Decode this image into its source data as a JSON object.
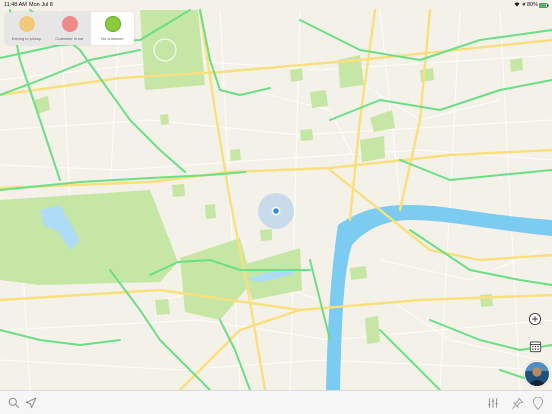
{
  "status_bar": {
    "time": "11:48 AM",
    "date": "Mon Jul 8",
    "battery": "80%"
  },
  "status_segment": {
    "options": [
      {
        "label": "Driving to pickup",
        "color": "#f2c879",
        "active": false
      },
      {
        "label": "Customer in car",
        "color": "#ee8a8a",
        "active": false
      },
      {
        "label": "No customer",
        "color": "#8acc3a",
        "active": true
      }
    ]
  },
  "map": {
    "colors": {
      "land": "#f4f1e8",
      "park": "#c6e6a6",
      "river": "#7ccbf0",
      "major_road": "#f9e07c",
      "road": "#ffffff",
      "cycle": "#6adf86",
      "location": "#2f8cf0"
    }
  },
  "controls": {
    "zoom_in_icon": "plus-circle-icon",
    "calendar_icon": "calendar-icon"
  },
  "bottom_bar": {
    "icons": [
      "search-icon",
      "navigate-arrow-icon",
      "filters-icon",
      "pin-icon",
      "map-pin-icon"
    ]
  }
}
